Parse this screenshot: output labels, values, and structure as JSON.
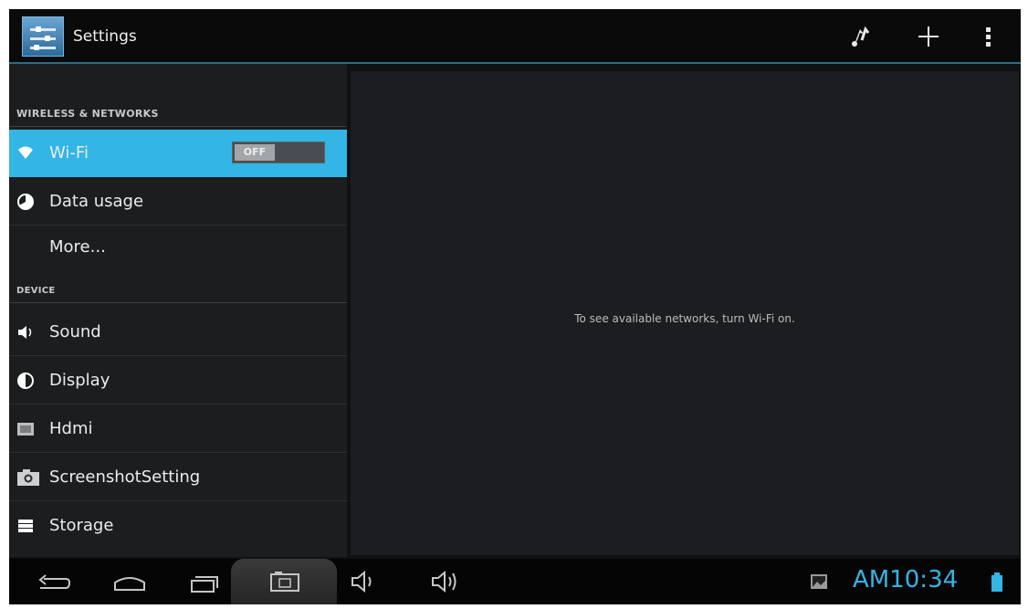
{
  "actionbar": {
    "title": "Settings",
    "icons": [
      "settings-app-icon",
      "scan-icon",
      "add-icon",
      "overflow-menu-icon"
    ]
  },
  "sidebar": {
    "sections": [
      {
        "header": "WIRELESS & NETWORKS",
        "items": [
          {
            "label": "Wi-Fi",
            "icon": "wifi-icon",
            "selected": true,
            "toggle": "OFF"
          },
          {
            "label": "Data usage",
            "icon": "data-usage-icon"
          },
          {
            "label": "More...",
            "icon": ""
          }
        ]
      },
      {
        "header": "DEVICE",
        "items": [
          {
            "label": "Sound",
            "icon": "sound-icon"
          },
          {
            "label": "Display",
            "icon": "display-icon"
          },
          {
            "label": "Hdmi",
            "icon": "hdmi-icon"
          },
          {
            "label": "ScreenshotSetting",
            "icon": "screenshot-icon"
          },
          {
            "label": "Storage",
            "icon": "storage-icon"
          }
        ]
      }
    ]
  },
  "detail": {
    "message": "To see available networks, turn Wi-Fi on."
  },
  "navbar": {
    "buttons": [
      "back-icon",
      "home-icon",
      "recents-icon",
      "screenshot-icon",
      "volume-down-icon",
      "volume-up-icon"
    ],
    "status_icons": [
      "gallery-notification-icon",
      "battery-icon"
    ],
    "clock": "AM10:34"
  },
  "colors": {
    "accent": "#33b5e5",
    "background": "#101112",
    "pane": "#1b1d1f"
  }
}
